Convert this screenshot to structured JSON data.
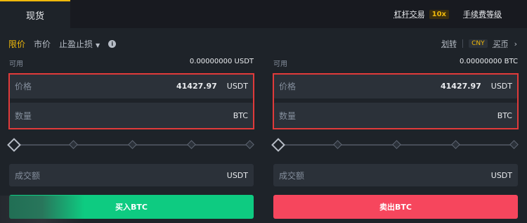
{
  "tabs": {
    "spot": "现货"
  },
  "top_right": {
    "margin": "杠杆交易",
    "leverage": "10x",
    "fee_level": "手续费等级"
  },
  "order_types": {
    "limit": "限价",
    "market": "市价",
    "stop": "止盈止损"
  },
  "actions": {
    "transfer": "划转",
    "currency": "CNY",
    "buy_coin": "买币"
  },
  "buy": {
    "available_label": "可用",
    "available_value": "0.00000000 USDT",
    "price_label": "价格",
    "price_value": "41427.97",
    "price_unit": "USDT",
    "qty_label": "数量",
    "qty_unit": "BTC",
    "total_label": "成交额",
    "total_unit": "USDT",
    "button": "买入BTC"
  },
  "sell": {
    "available_label": "可用",
    "available_value": "0.00000000 BTC",
    "price_label": "价格",
    "price_value": "41427.97",
    "price_unit": "USDT",
    "qty_label": "数量",
    "qty_unit": "BTC",
    "total_label": "成交额",
    "total_unit": "USDT",
    "button": "卖出BTC"
  },
  "colors": {
    "accent": "#f0b90b",
    "buy": "#0ecb81",
    "sell": "#f6465d",
    "highlight": "#e03a3a"
  }
}
